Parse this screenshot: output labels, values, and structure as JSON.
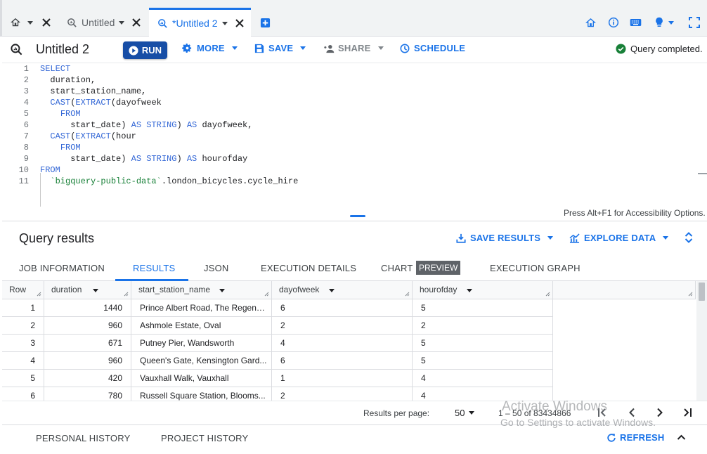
{
  "tabs": [
    {
      "label": "Untitled",
      "active": false
    },
    {
      "label": "*Untitled 2",
      "active": true
    }
  ],
  "toolbar": {
    "title": "Untitled 2",
    "run": "RUN",
    "more": "MORE",
    "save": "SAVE",
    "share": "SHARE",
    "schedule": "SCHEDULE",
    "status": "Query completed."
  },
  "editor": {
    "line_numbers": [
      "1",
      "2",
      "3",
      "4",
      "5",
      "6",
      "7",
      "8",
      "9",
      "10",
      "11"
    ],
    "accessibility_hint": "Press Alt+F1 for Accessibility Options."
  },
  "results": {
    "title": "Query results",
    "save_results": "SAVE RESULTS",
    "explore_data": "EXPLORE DATA",
    "tabs": [
      "JOB INFORMATION",
      "RESULTS",
      "JSON",
      "EXECUTION DETAILS",
      "CHART",
      "EXECUTION GRAPH"
    ],
    "preview_badge": "PREVIEW",
    "columns": [
      "Row",
      "duration",
      "start_station_name",
      "dayofweek",
      "hourofday"
    ],
    "rows": [
      [
        "1",
        "1440",
        "Prince Albert Road, The Regent'...",
        "6",
        "5"
      ],
      [
        "2",
        "960",
        "Ashmole Estate, Oval",
        "2",
        "2"
      ],
      [
        "3",
        "671",
        "Putney Pier, Wandsworth",
        "4",
        "5"
      ],
      [
        "4",
        "960",
        "Queen's Gate, Kensington Gard...",
        "6",
        "5"
      ],
      [
        "5",
        "420",
        "Vauxhall Walk, Vauxhall",
        "1",
        "4"
      ],
      [
        "6",
        "780",
        "Russell Square Station, Blooms...",
        "2",
        "4"
      ]
    ]
  },
  "pager": {
    "per_page_label": "Results per page:",
    "per_page_value": "50",
    "range": "1 – 50 of 83434866"
  },
  "watermark": {
    "line1": "Activate Windows",
    "line2": "Go to Settings to activate Windows."
  },
  "history": {
    "personal": "PERSONAL HISTORY",
    "project": "PROJECT HISTORY",
    "refresh": "REFRESH"
  },
  "colors": {
    "accent": "#1a73e8",
    "run_button": "#174ea6",
    "status_ok": "#188038",
    "keyword": "#3367d6",
    "string": "#188038"
  }
}
